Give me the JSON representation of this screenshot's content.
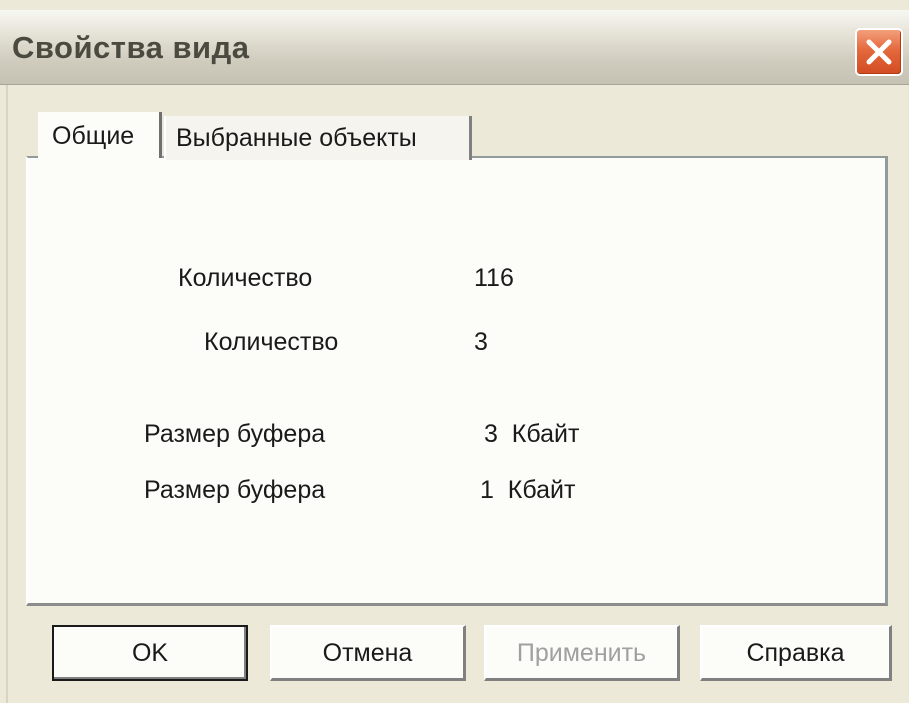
{
  "window": {
    "title": "Свойства вида"
  },
  "tabs": [
    {
      "label": "Общие",
      "selected": true
    },
    {
      "label": "Выбранные объекты",
      "selected": false
    }
  ],
  "properties": [
    {
      "label": "Количество",
      "value": "116"
    },
    {
      "label": "Количество",
      "value": "3"
    },
    {
      "label": "Размер буфера",
      "value": "3  Кбайт"
    },
    {
      "label": "Размер буфера",
      "value": "1  Кбайт"
    }
  ],
  "buttons": {
    "ok": "OK",
    "cancel": "Отмена",
    "apply": "Применить",
    "help": "Справка"
  },
  "colors": {
    "close_button": "#e5683d",
    "panel_background": "#fcfcf8",
    "disabled_text": "#a0a0a0"
  },
  "icons": {
    "close": "close-icon"
  }
}
